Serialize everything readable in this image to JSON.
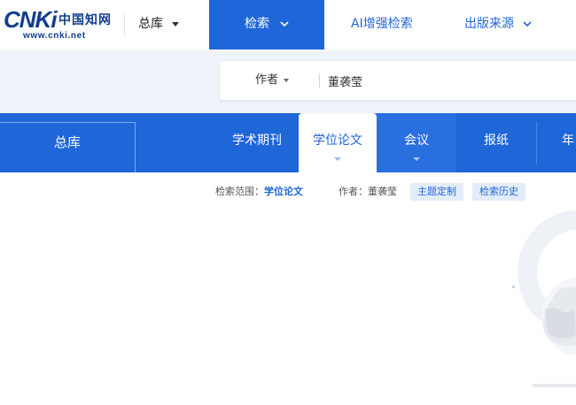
{
  "header": {
    "logo_main": "CNKi",
    "logo_cn": "中国知网",
    "logo_url": "www.cnki.net",
    "nav_zongku": "总库",
    "nav_search": "检索",
    "nav_ai": "AI增强检索",
    "nav_source": "出版来源"
  },
  "search": {
    "field": "作者",
    "value": "董袭莹"
  },
  "tabs": {
    "zongku": "总库",
    "items": [
      {
        "label": "学术期刊"
      },
      {
        "label": "学位论文"
      },
      {
        "label": "会议"
      },
      {
        "label": "报纸"
      },
      {
        "label": "年"
      }
    ]
  },
  "info": {
    "scope_label": "检索范围：",
    "scope_value": "学位论文",
    "author_label": "作者：",
    "author_value": "董袭莹",
    "topic_button": "主题定制",
    "history_button": "检索历史"
  },
  "colors": {
    "brand_blue": "#1f66d9",
    "logo_navy": "#123e8c"
  }
}
